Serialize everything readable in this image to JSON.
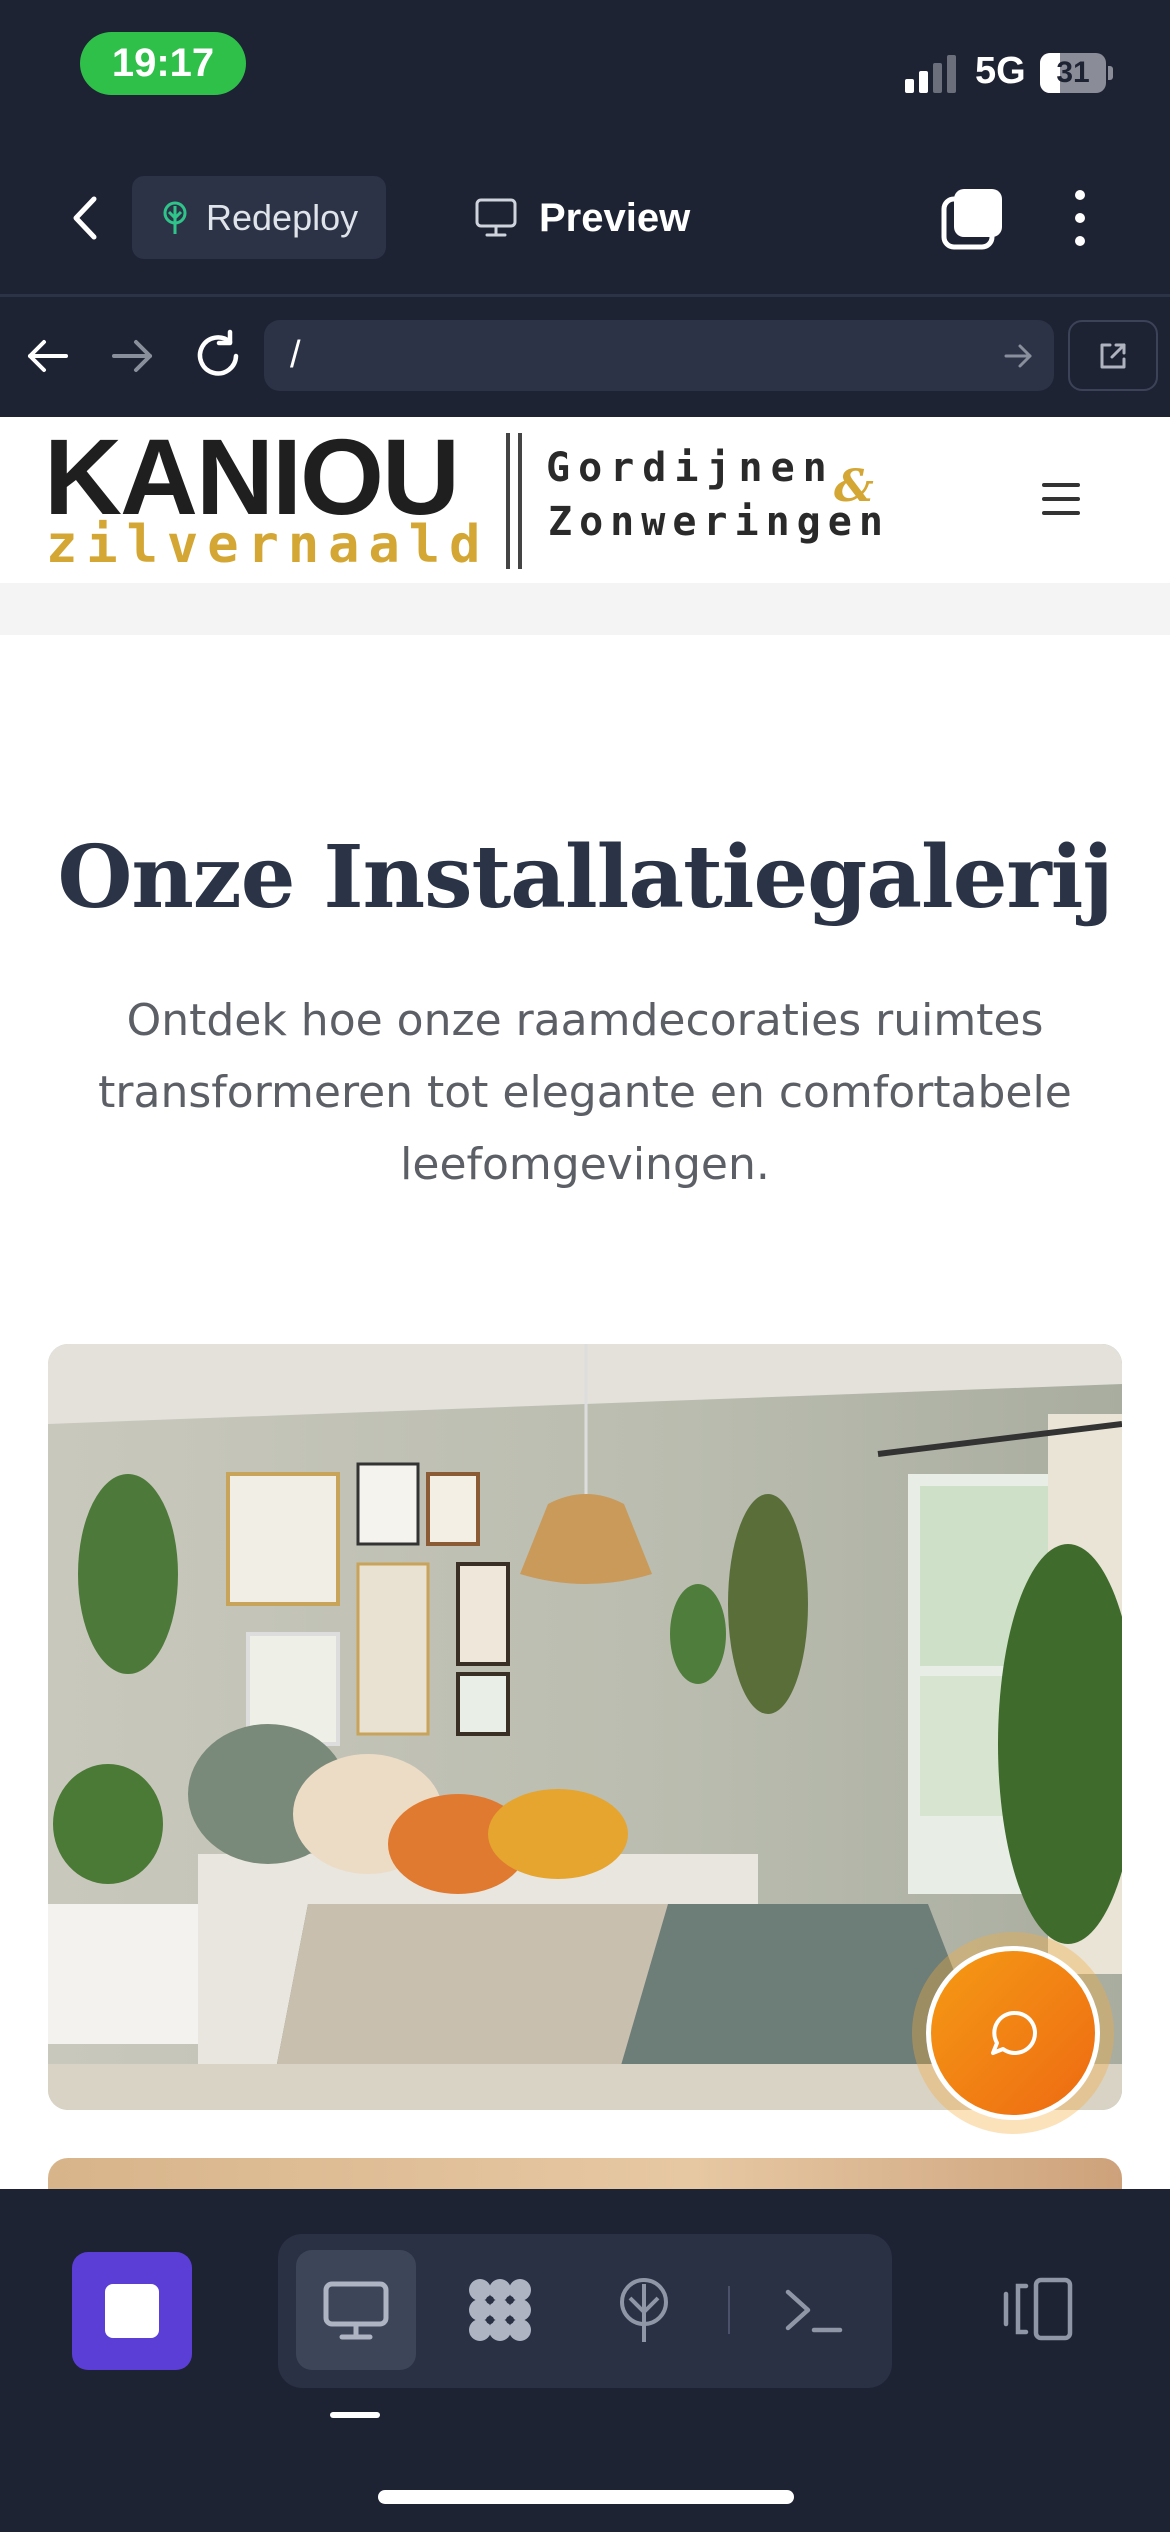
{
  "status_bar": {
    "time": "19:17",
    "network": "5G",
    "battery": "31",
    "battery_level": 0.31
  },
  "toolbar": {
    "redeploy_label": "Redeploy",
    "preview_label": "Preview"
  },
  "browser": {
    "url": "/"
  },
  "site": {
    "logo": {
      "brand": "KANIOU",
      "sub": "zilvernaald",
      "tag_line1": "Gordijnen",
      "tag_amp": "&",
      "tag_line2": "Zonweringen"
    },
    "headline": "Onze Installatiegalerij",
    "subtext": "Ontdek hoe onze raamdecoraties ruimtes transformeren tot elegante en comfortabele leefomgevingen."
  },
  "colors": {
    "app_bg": "#1e2334",
    "accent_purple": "#5b3ed6",
    "time_pill": "#2fc04a",
    "logo_gold": "#d4a634",
    "heading_navy": "#2b3447",
    "chat_orange": "#f28a14"
  },
  "icons": {
    "back": "chevron-left-icon",
    "redeploy": "tree-icon",
    "preview": "monitor-icon",
    "tabs": "tabs-icon",
    "more": "kebab-icon",
    "chat": "chat-bubble-icon"
  }
}
